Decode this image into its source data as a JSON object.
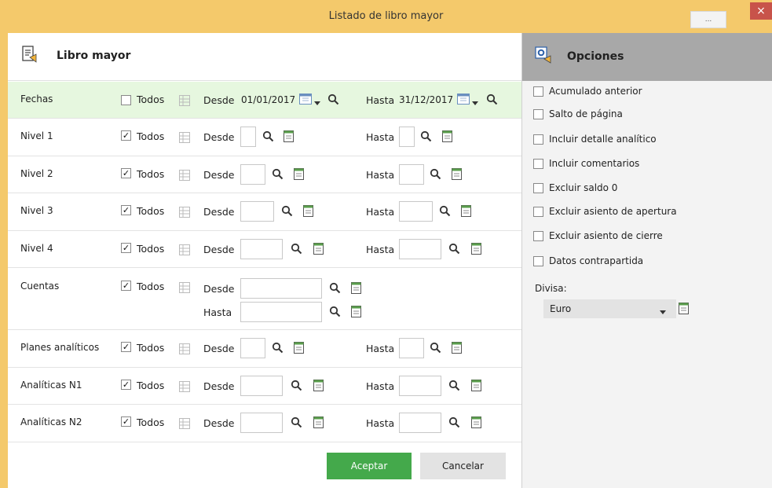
{
  "window": {
    "title": "Listado de libro mayor",
    "more_label": "...",
    "close_label": "×"
  },
  "main": {
    "title": "Libro mayor",
    "rows": {
      "fechas": {
        "label": "Fechas",
        "todos_label": "Todos",
        "todos_checked": false,
        "desde_label": "Desde",
        "desde_value": "01/01/2017",
        "hasta_label": "Hasta",
        "hasta_value": "31/12/2017"
      },
      "nivel1": {
        "label": "Nivel 1",
        "todos_label": "Todos",
        "todos_checked": true,
        "desde_label": "Desde",
        "hasta_label": "Hasta"
      },
      "nivel2": {
        "label": "Nivel 2",
        "todos_label": "Todos",
        "todos_checked": true,
        "desde_label": "Desde",
        "hasta_label": "Hasta"
      },
      "nivel3": {
        "label": "Nivel 3",
        "todos_label": "Todos",
        "todos_checked": true,
        "desde_label": "Desde",
        "hasta_label": "Hasta"
      },
      "nivel4": {
        "label": "Nivel 4",
        "todos_label": "Todos",
        "todos_checked": true,
        "desde_label": "Desde",
        "hasta_label": "Hasta"
      },
      "cuentas": {
        "label": "Cuentas",
        "todos_label": "Todos",
        "todos_checked": true,
        "desde_label": "Desde",
        "hasta_label": "Hasta"
      },
      "planes": {
        "label": "Planes  analíticos",
        "todos_label": "Todos",
        "todos_checked": true,
        "desde_label": "Desde",
        "hasta_label": "Hasta"
      },
      "an1": {
        "label": "Analíticas  N1",
        "todos_label": "Todos",
        "todos_checked": true,
        "desde_label": "Desde",
        "hasta_label": "Hasta"
      },
      "an2": {
        "label": "Analíticas  N2",
        "todos_label": "Todos",
        "todos_checked": true,
        "desde_label": "Desde",
        "hasta_label": "Hasta"
      }
    },
    "buttons": {
      "accept": "Aceptar",
      "cancel": "Cancelar"
    }
  },
  "options": {
    "title": "Opciones",
    "items": [
      {
        "label": "Acumulado anterior",
        "checked": false
      },
      {
        "label": "Salto de página",
        "checked": false
      },
      {
        "label": "Incluir detalle analítico",
        "checked": false
      },
      {
        "label": "Incluir comentarios",
        "checked": false
      },
      {
        "label": "Excluir saldo 0",
        "checked": false
      },
      {
        "label": "Excluir asiento de apertura",
        "checked": false
      },
      {
        "label": "Excluir asiento de cierre",
        "checked": false
      },
      {
        "label": "Datos  contrapartida",
        "checked": false
      }
    ],
    "divisa_label": "Divisa:",
    "divisa_value": "Euro"
  },
  "colors": {
    "title_bar": "#f4c96b",
    "highlight_row": "#e6f7df",
    "accept_button": "#44a94b",
    "close_button": "#c8534a",
    "options_header": "#a8a8a8"
  }
}
